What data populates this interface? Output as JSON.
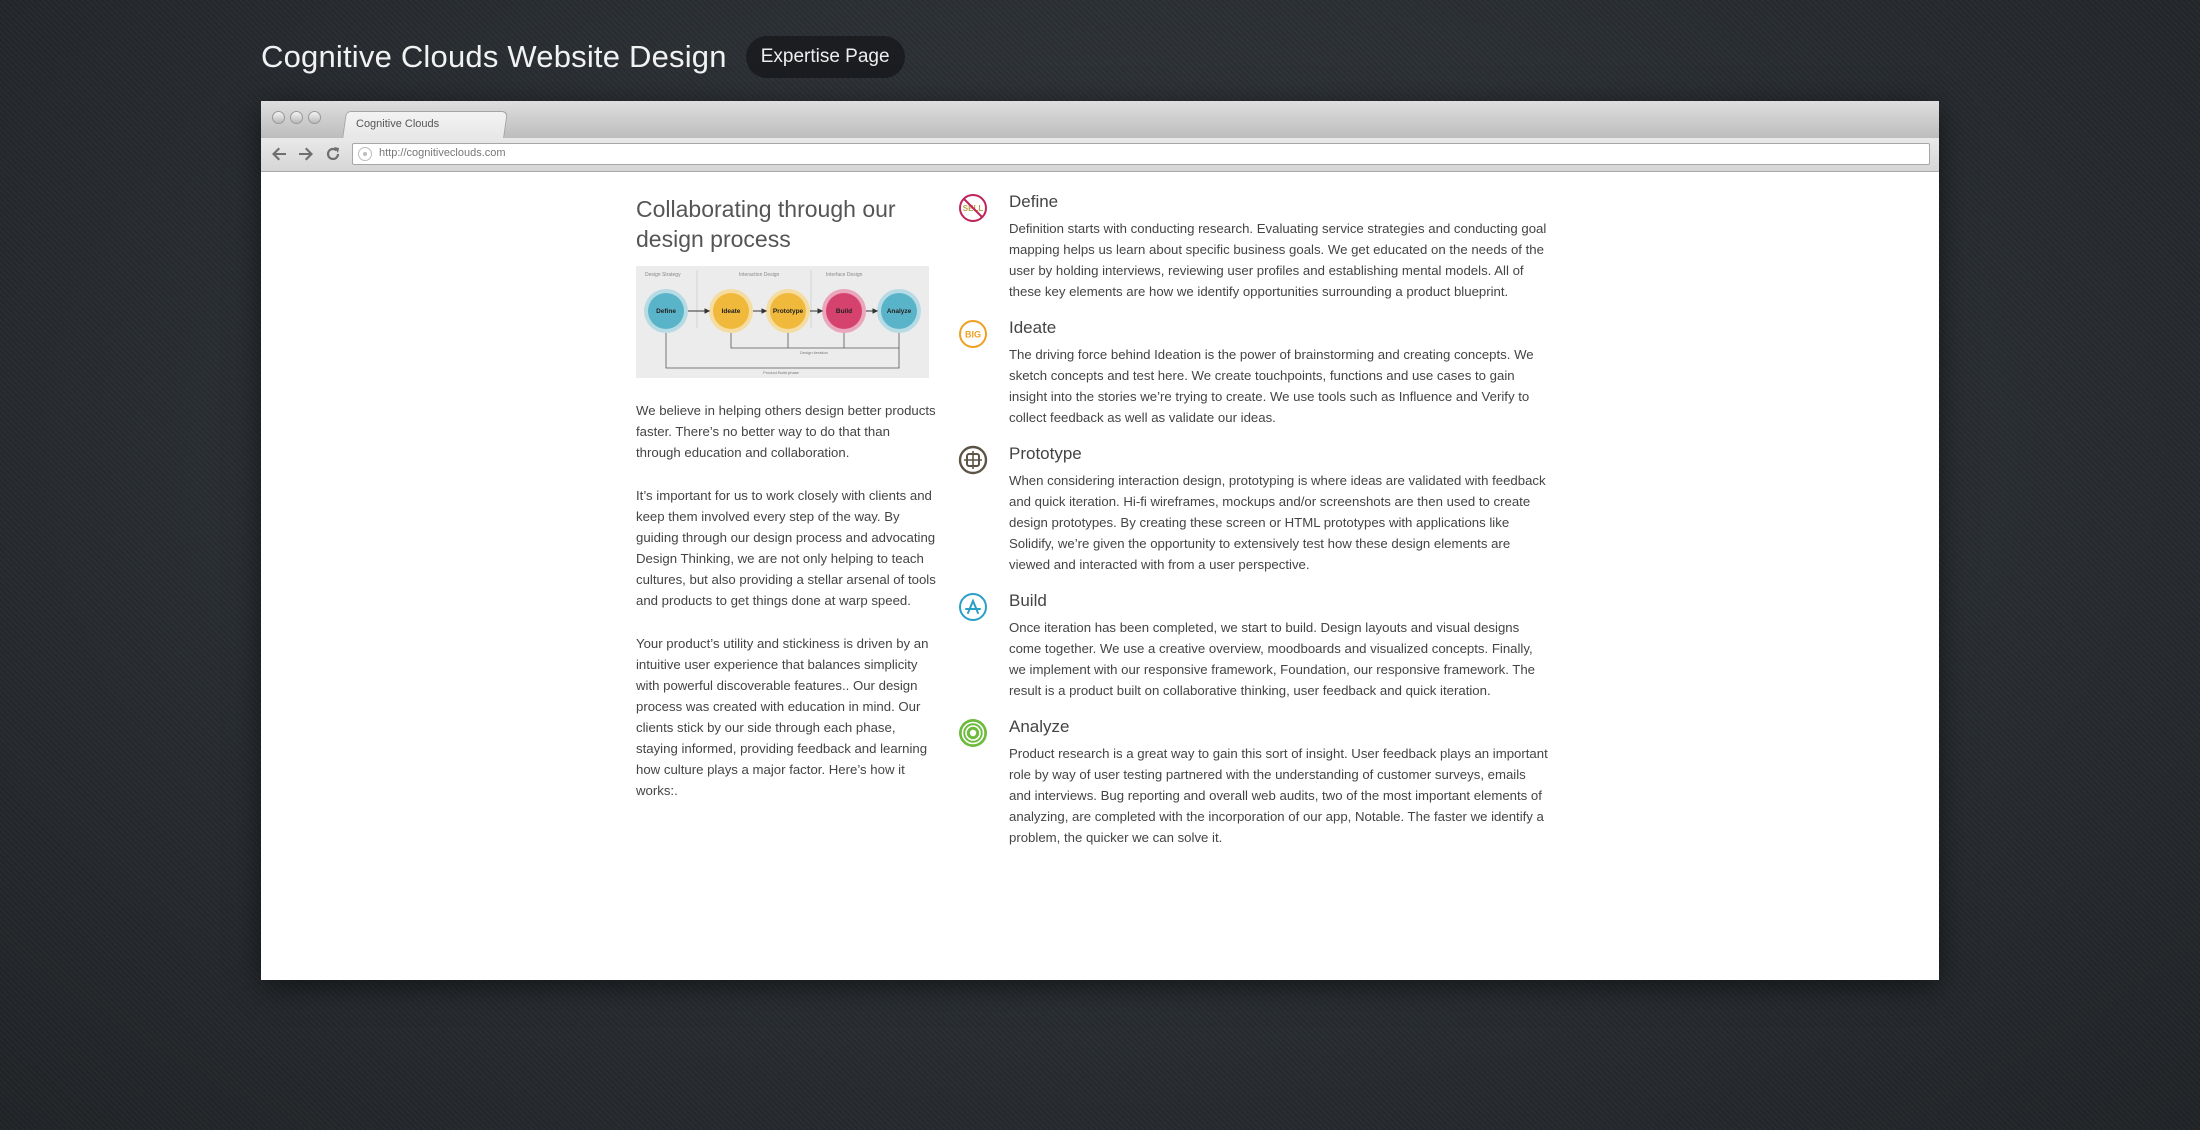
{
  "header": {
    "title": "Cognitive Clouds Website Design",
    "badge": "Expertise Page"
  },
  "browser": {
    "tab_title": "Cognitive Clouds",
    "url": "http://cognitiveclouds.com"
  },
  "intro": {
    "heading": "Collaborating through our design process",
    "paragraphs": [
      "We believe in helping others design better products faster. There’s no better way to do that than through education and collaboration.",
      "It’s important for us to work closely with clients and keep them involved every step of the way. By guiding through our design process and advocating Design Thinking, we are not only helping to teach cultures, but also providing a stellar arsenal of tools and products to get things done at warp speed.",
      "Your product’s utility and stickiness is driven by an intuitive user experience that balances simplicity with powerful discoverable features.. Our design process was created with education in mind. Our clients stick by our side through each phase, staying informed, providing feedback and learning how culture plays a major factor. Here’s how it works:."
    ]
  },
  "diagram": {
    "groups": [
      "Design Strategy",
      "Interaction Design",
      "Interface Design"
    ],
    "nodes": [
      "Define",
      "Ideate",
      "Prototype",
      "Build",
      "Analyze"
    ],
    "loop_labels": [
      "Design iteration",
      "Product Build phase"
    ],
    "colors": {
      "define": "#5ab4c9",
      "ideate": "#f1b93b",
      "prototype": "#f1b93b",
      "build": "#d6426e",
      "analyze": "#5ab4c9"
    }
  },
  "steps": [
    {
      "icon": "no-sell-icon",
      "icon_text": "SELL",
      "title": "Define",
      "text": "Definition starts with conducting research. Evaluating service strategies and conducting goal mapping helps us learn about specific business goals. We get educated on the needs of the user by holding interviews, reviewing user profiles and establishing mental models. All of these key elements are how we identify opportunities surrounding a product blueprint."
    },
    {
      "icon": "big-idea-icon",
      "icon_text": "BIG",
      "title": "Ideate",
      "text": "The driving force behind Ideation is the power of brainstorming and creating concepts. We sketch concepts and test here. We create touchpoints, functions and use cases to gain insight into the stories we’re trying to create. We use tools such as Influence and Verify to collect feedback as well as validate our ideas."
    },
    {
      "icon": "prototype-icon",
      "title": "Prototype",
      "text": "When considering interaction design, prototyping is where ideas are validated with feedback and quick iteration. Hi-fi wireframes, mockups and/or screenshots are then used to create design prototypes. By creating these screen or HTML prototypes with applications like Solidify, we’re given the opportunity to extensively test how these design elements are viewed and interacted with from a user perspective."
    },
    {
      "icon": "app-store-icon",
      "title": "Build",
      "text": "Once iteration has been completed, we start to build. Design layouts and visual designs come together. We use a creative overview, moodboards and visualized concepts. Finally, we implement with our responsive framework, Foundation, our responsive framework. The result is a product built on collaborative thinking, user feedback and quick iteration."
    },
    {
      "icon": "target-icon",
      "title": "Analyze",
      "text": "Product research is a great way to gain this sort of insight. User feedback plays an important role by way of user testing partnered with the understanding of customer surveys, emails and interviews. Bug reporting and overall web audits, two of the most important elements of analyzing, are completed with the incorporation of our app, Notable. The faster we identify a problem, the quicker we can solve it."
    }
  ],
  "colors": {
    "define": "#c0245c",
    "ideate": "#f0a020",
    "prototype": "#5d5446",
    "build": "#2a9fc7",
    "analyze": "#6cbb3c"
  }
}
